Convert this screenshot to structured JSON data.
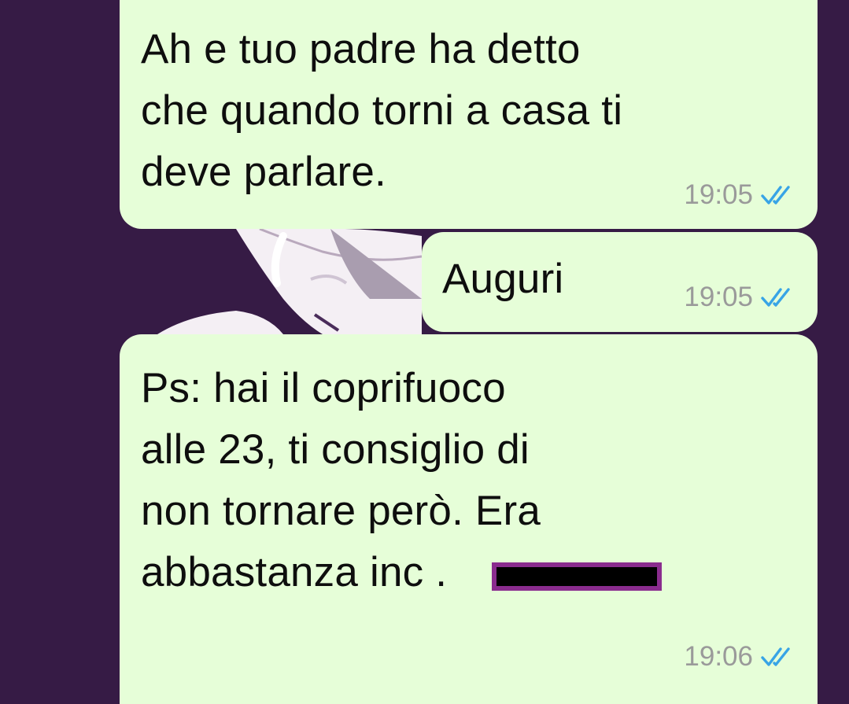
{
  "theme": {
    "background": "#361b45",
    "bubble_color": "#e6fed8",
    "timestamp_color": "#9a9a9a",
    "read_tick_color": "#38a4e6",
    "redaction_fill": "#000000",
    "redaction_border": "#8a2c8e"
  },
  "messages": [
    {
      "text": "Ah e tuo padre ha detto\nche quando torni a casa ti\ndeve parlare.",
      "time": "19:05",
      "status_icon": "double-check-icon"
    },
    {
      "text": "Auguri",
      "time": "19:05",
      "status_icon": "double-check-icon"
    },
    {
      "text": "Ps: hai il coprifuoco\nalle 23, ti consiglio di\nnon tornare però. Era\nabbastanza inc          .",
      "time": "19:06",
      "status_icon": "double-check-icon"
    }
  ]
}
